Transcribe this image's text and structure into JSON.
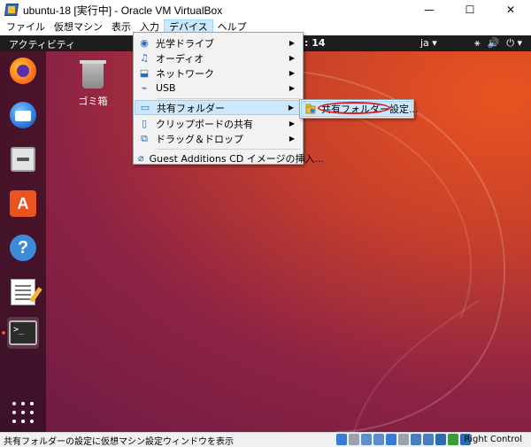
{
  "window": {
    "title": "ubuntu-18 [実行中] - Oracle VM VirtualBox",
    "minimize": "—",
    "maximize": "☐",
    "close": "✕"
  },
  "menubar": [
    "ファイル",
    "仮想マシン",
    "表示",
    "入力",
    "デバイス",
    "ヘルプ"
  ],
  "guest": {
    "activities": "アクティビティ",
    "clock": ": 14",
    "lang": "ja ▾",
    "tray": [
      "⚹",
      "🔊",
      "⏻ ▾"
    ],
    "trash_label": "ゴミ箱",
    "terminal_prompt": ">_"
  },
  "devices_menu": {
    "items": [
      {
        "label": "光学ドライブ",
        "icon": "optical-drive-icon",
        "glyph": "◉"
      },
      {
        "label": "オーディオ",
        "icon": "audio-icon",
        "glyph": "♫"
      },
      {
        "label": "ネットワーク",
        "icon": "network-icon",
        "glyph": "⬓"
      },
      {
        "label": "USB",
        "icon": "usb-icon",
        "glyph": "⌁"
      },
      {
        "label": "共有フォルダー",
        "icon": "shared-folder-icon",
        "glyph": "▭"
      },
      {
        "label": "クリップボードの共有",
        "icon": "clipboard-icon",
        "glyph": "▯"
      },
      {
        "label": "ドラッグ＆ドロップ",
        "icon": "drag-drop-icon",
        "glyph": "⧉"
      },
      {
        "label": "Guest Additions CD イメージの挿入...",
        "icon": "guest-additions-icon",
        "glyph": "⌀"
      }
    ],
    "arrow": "▶"
  },
  "shared_folder_submenu": {
    "label": "共有フォルダー設定..."
  },
  "statusbar": {
    "text": "共有フォルダーの設定に仮想マシン設定ウィンドウを表示",
    "host_key": "Right Control",
    "icon_colors": [
      "#3a7bd5",
      "#9aa3ad",
      "#5d8fd0",
      "#5d8fd0",
      "#3a7bd5",
      "#9aa3ad",
      "#4a7fbf",
      "#4a7fbf",
      "#2b6cb0",
      "#3c9a3c",
      "#2b6cb0"
    ]
  },
  "colors": {
    "accent": "#e95420",
    "menu_highlight": "#cce8ff",
    "highlight_border": "#99d1ff",
    "annotation_ring": "#e02020"
  }
}
